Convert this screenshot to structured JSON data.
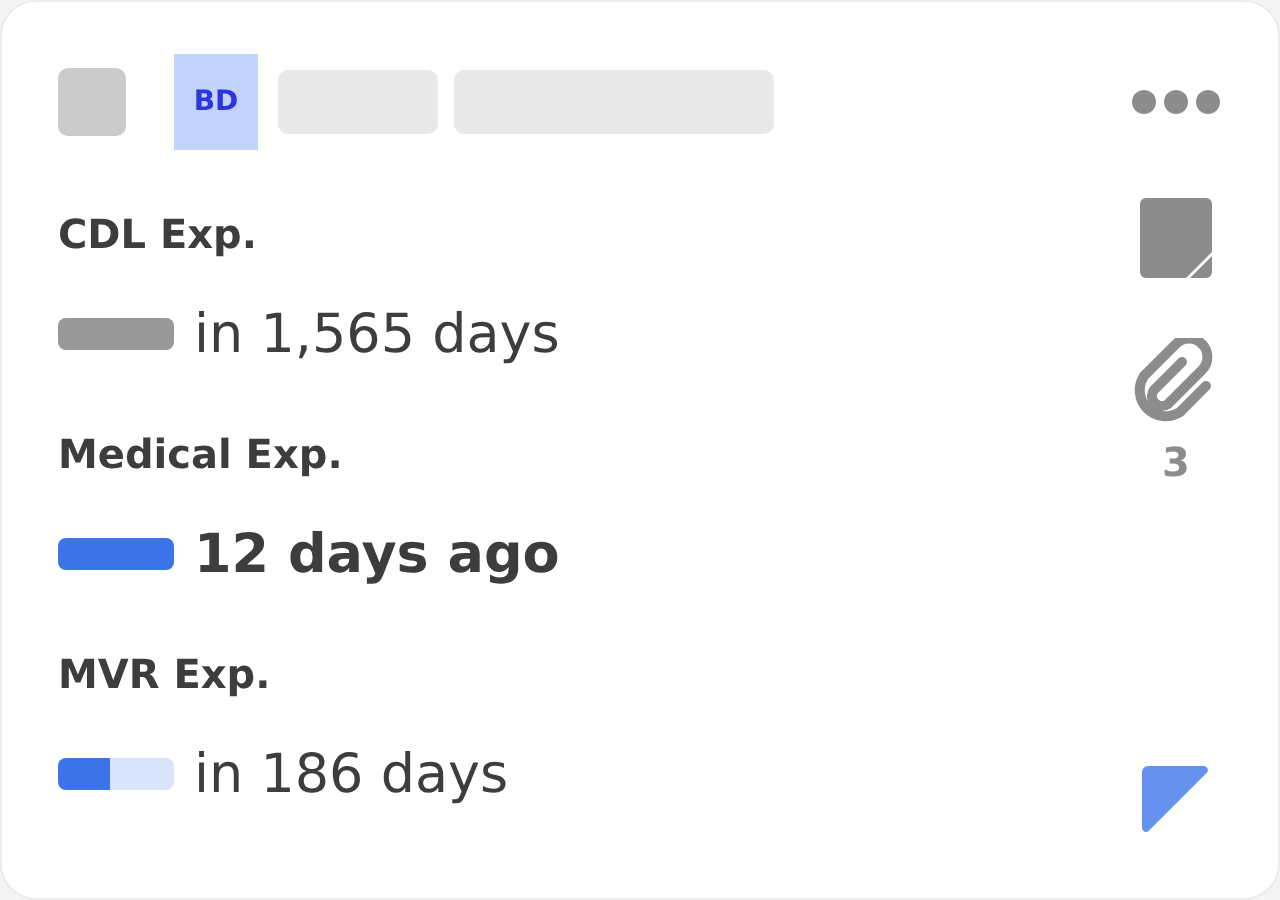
{
  "header": {
    "checked": false,
    "avatar": "BD"
  },
  "expirations": [
    {
      "label": "CDL Exp.",
      "value": "in 1,565 days",
      "overdue": false,
      "level": 1,
      "color": "#999999"
    },
    {
      "label": "Medical Exp.",
      "value": "12 days ago",
      "overdue": true,
      "level": 1,
      "color": "#3b73e8"
    },
    {
      "label": "MVR Exp.",
      "value": "in 186 days",
      "overdue": false,
      "level": 0.45,
      "color": "#3b73e8"
    }
  ],
  "attachments": {
    "count": "3"
  }
}
